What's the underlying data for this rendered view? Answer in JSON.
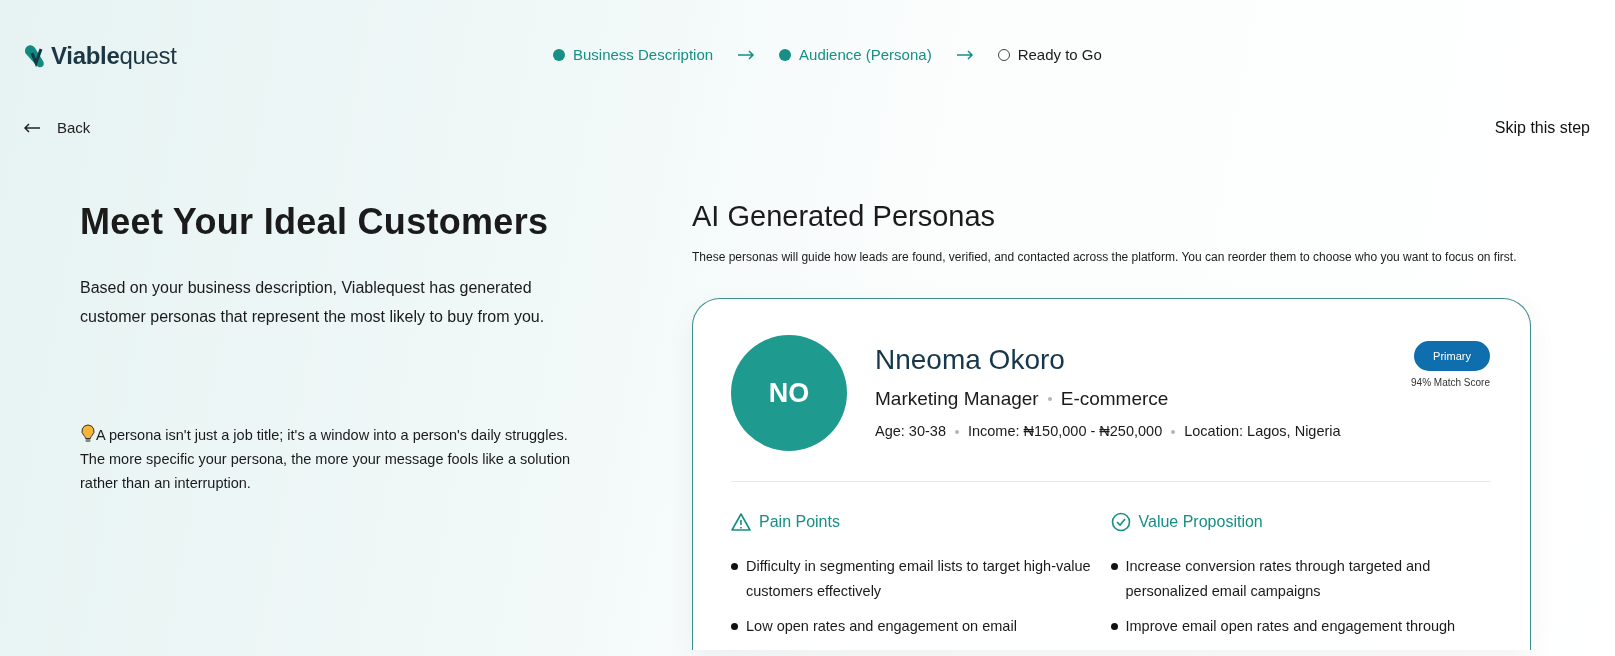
{
  "brand": {
    "name": "**Viable**quest"
  },
  "steps": [
    {
      "label": "Business Description",
      "done": true
    },
    {
      "label": "Audience (Persona)",
      "done": true
    },
    {
      "label": "Ready to Go",
      "done": false
    }
  ],
  "back": {
    "label": "Back"
  },
  "skip": {
    "label": "Skip this step"
  },
  "intro": {
    "title": "Meet Your Ideal Customers",
    "text": "Based on your business description, Viablequest has generated customer personas that represent the most likely to buy from you.",
    "tip": "A persona isn't just a job title; it's a window into a person's daily struggles. The more specific your persona, the more your message fools like a solution rather than an interruption."
  },
  "personas_section": {
    "title": "AI Generated Personas",
    "subtitle": "These personas will guide how leads are found, verified, and contacted across the platform. You can reorder them to choose who you want to focus on first."
  },
  "persona": {
    "initials": "NO",
    "name": "Nneoma Okoro",
    "role": "Marketing Manager",
    "industry": "E-commerce",
    "primary": true,
    "primary_label": "Primary",
    "match": "94% Match Score",
    "details": [
      "Age: 30-38",
      "Income: ₦150,000 - ₦250,000",
      "Location: Lagos, Nigeria"
    ],
    "sections": [
      {
        "kind": "pain",
        "title": "Pain Points",
        "items": [
          "Difficulty in segmenting email lists to target high-value customers effectively",
          "Low open rates and engagement on email"
        ]
      },
      {
        "kind": "value",
        "title": "Value Proposition",
        "items": [
          "Increase conversion rates through targeted and personalized email campaigns",
          "Improve email open rates and engagement through"
        ]
      }
    ]
  }
}
